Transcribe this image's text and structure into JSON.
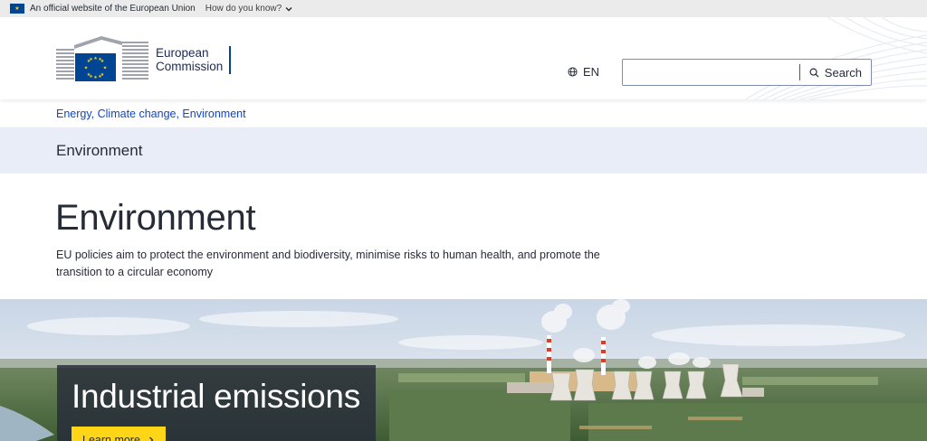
{
  "eu_bar": {
    "official_text": "An official website of the European Union",
    "how_text": "How do you know?",
    "flag_icon": "eu-flag-icon",
    "chevron_icon": "chevron-down-icon"
  },
  "header": {
    "logo_line1": "European",
    "logo_line2": "Commission",
    "language": "EN",
    "language_icon": "globe-icon",
    "search": {
      "placeholder": "",
      "value": "",
      "button_label": "Search",
      "icon": "search-icon"
    }
  },
  "breadcrumb": {
    "items": [
      "Energy, Climate change, Environment"
    ]
  },
  "site_band": {
    "title": "Environment"
  },
  "page": {
    "title": "Environment",
    "description": "EU policies aim to protect the environment and biodiversity, minimise risks to human health, and promote the transition to a circular economy"
  },
  "hero": {
    "title": "Industrial emissions",
    "button_label": "Learn more",
    "button_icon": "chevron-right-icon"
  },
  "colors": {
    "eu_blue": "#004494",
    "eu_yellow": "#ffd617",
    "link_blue": "#0e47cb",
    "band_bg": "#e9edf7",
    "text": "#262b38"
  }
}
